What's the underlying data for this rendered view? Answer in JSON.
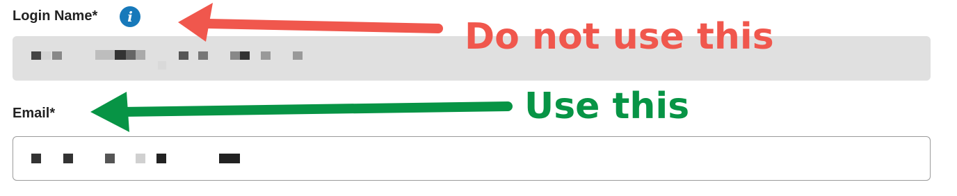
{
  "colors": {
    "info_icon": "#1779ba",
    "disabled_field_bg": "#e0e0e0",
    "label_text": "#222222",
    "warn_arrow": "#f0574d",
    "ok_arrow": "#079445"
  },
  "form": {
    "login_name": {
      "label": "Login Name*",
      "info_icon": "info-icon",
      "state": "disabled",
      "value_redacted": true
    },
    "email": {
      "label": "Email*",
      "state": "enabled",
      "value_redacted": true
    }
  },
  "annotations": {
    "do_not_use": "Do not use this",
    "use": "Use this"
  }
}
